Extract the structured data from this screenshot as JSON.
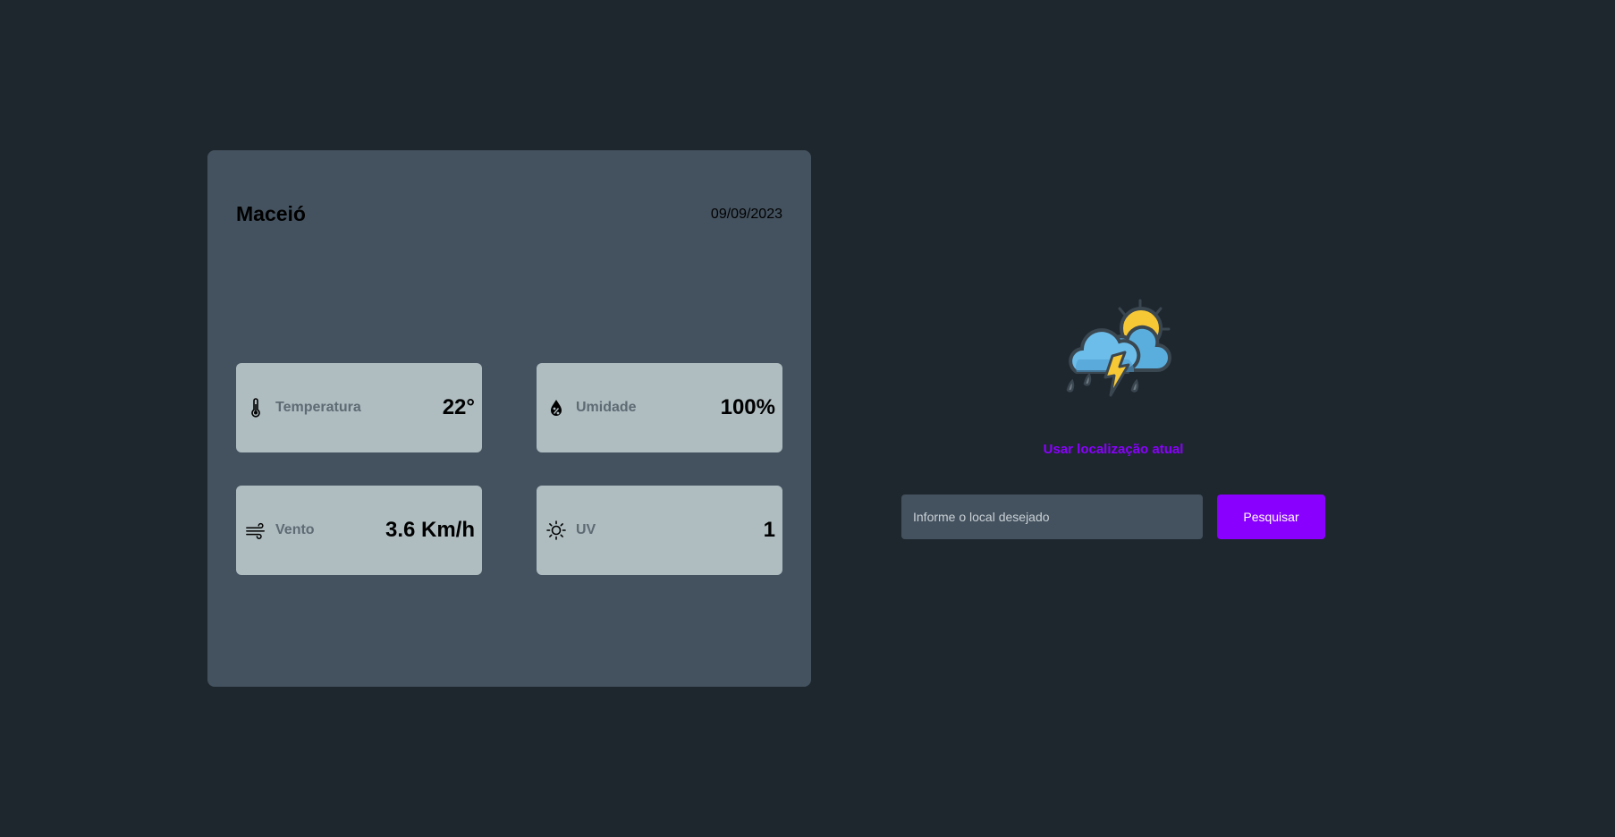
{
  "weather_card": {
    "city": "Maceió",
    "date": "09/09/2023",
    "metrics": {
      "temperature": {
        "label": "Temperatura",
        "value": "22°",
        "icon": "thermometer-icon"
      },
      "humidity": {
        "label": "Umidade",
        "value": "100%",
        "icon": "humidity-drop-icon"
      },
      "wind": {
        "label": "Vento",
        "value": "3.6 Km/h",
        "icon": "wind-icon"
      },
      "uv": {
        "label": "UV",
        "value": "1",
        "icon": "sun-icon"
      }
    }
  },
  "side_panel": {
    "illustration_icon": "thunderstorm-rain-sun-icon",
    "location_link": "Usar localização atual",
    "search": {
      "placeholder": "Informe o local desejado",
      "value": "",
      "button_label": "Pesquisar"
    }
  },
  "colors": {
    "background": "#1e272e",
    "card": "#44525f",
    "tile": "#afbdc1",
    "accent": "#8a00ff"
  }
}
